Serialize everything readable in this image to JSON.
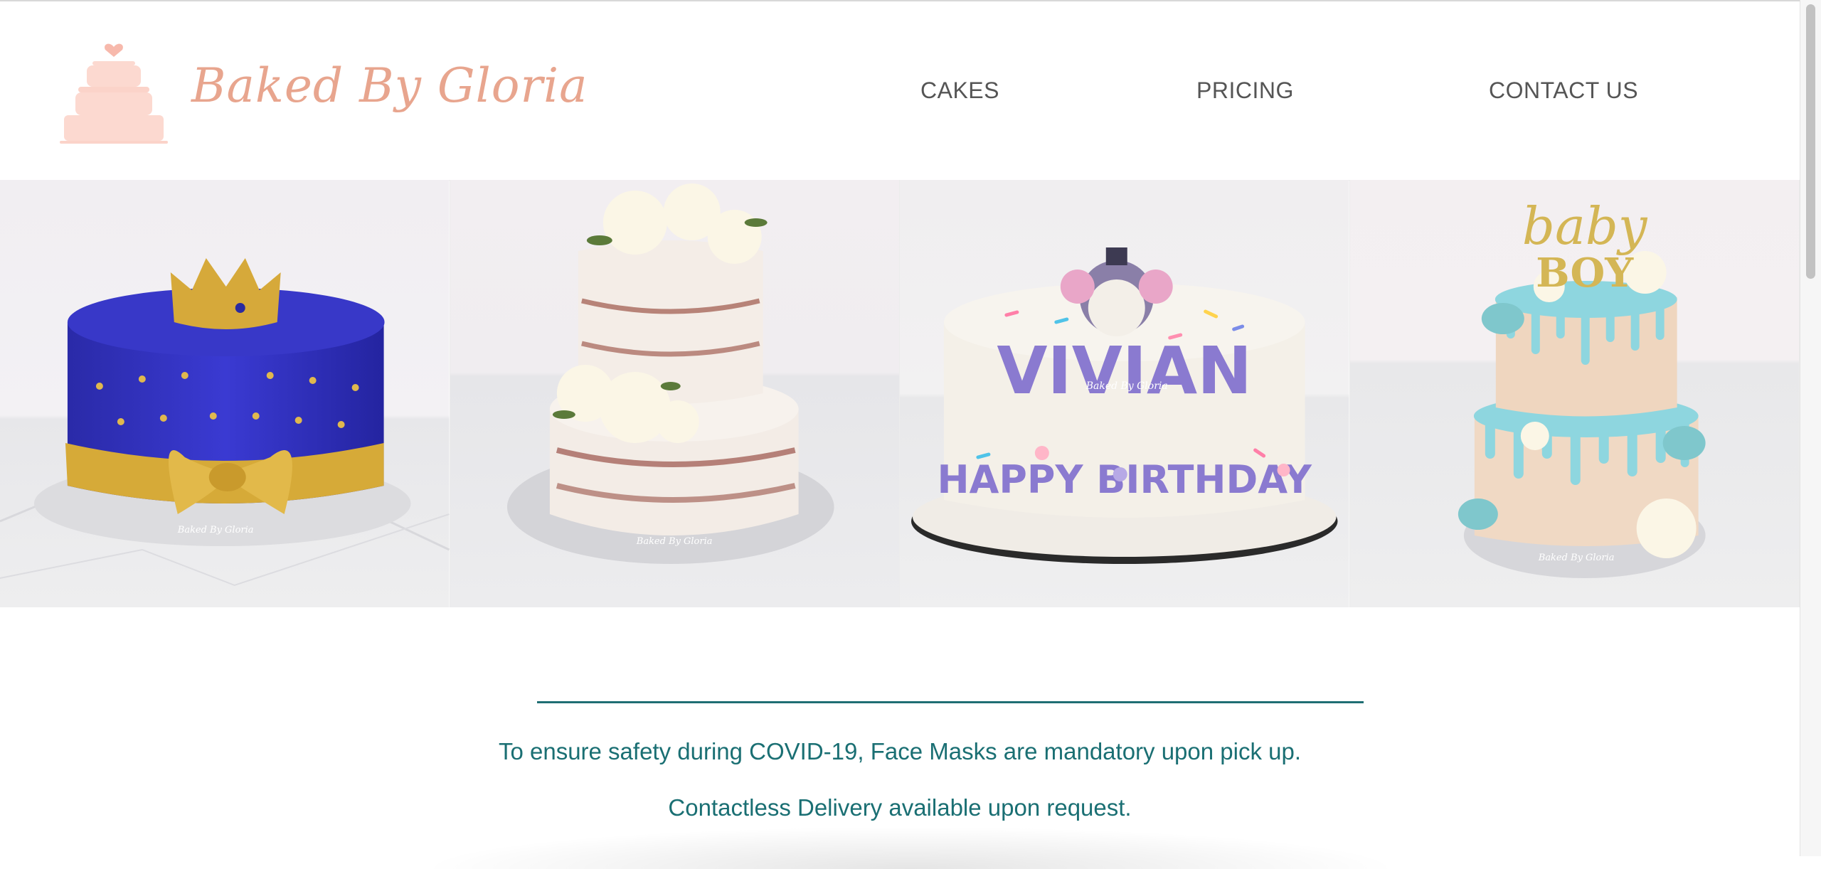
{
  "header": {
    "brand_name": "Baked By Gloria",
    "logo_icon": "cake-icon",
    "nav": [
      {
        "label": "CAKES"
      },
      {
        "label": "PRICING"
      },
      {
        "label": "CONTACT US"
      }
    ]
  },
  "gallery": {
    "items": [
      {
        "icon": "royal-crown-cake-photo",
        "cake_text": "",
        "watermark": "Baked By Gloria"
      },
      {
        "icon": "naked-floral-cake-photo",
        "cake_text": "",
        "watermark": "Baked By Gloria"
      },
      {
        "icon": "vivian-birthday-cake-photo",
        "cake_text": "VIVIAN",
        "cake_text_2": "HAPPY BIRTHDAY",
        "watermark": "Baked By Gloria"
      },
      {
        "icon": "baby-boy-drip-cake-photo",
        "topper_1": "baby",
        "topper_2": "BOY",
        "watermark": "Baked By Gloria"
      }
    ]
  },
  "notice": {
    "line1": "To ensure safety during COVID-19, Face Masks are mandatory upon pick up.",
    "line2": "Contactless Delivery available upon request."
  },
  "colors": {
    "brand": "#e8a58e",
    "logo_pink": "#fcd9d0",
    "nav_text": "#555555",
    "notice_teal": "#1a6f73"
  }
}
